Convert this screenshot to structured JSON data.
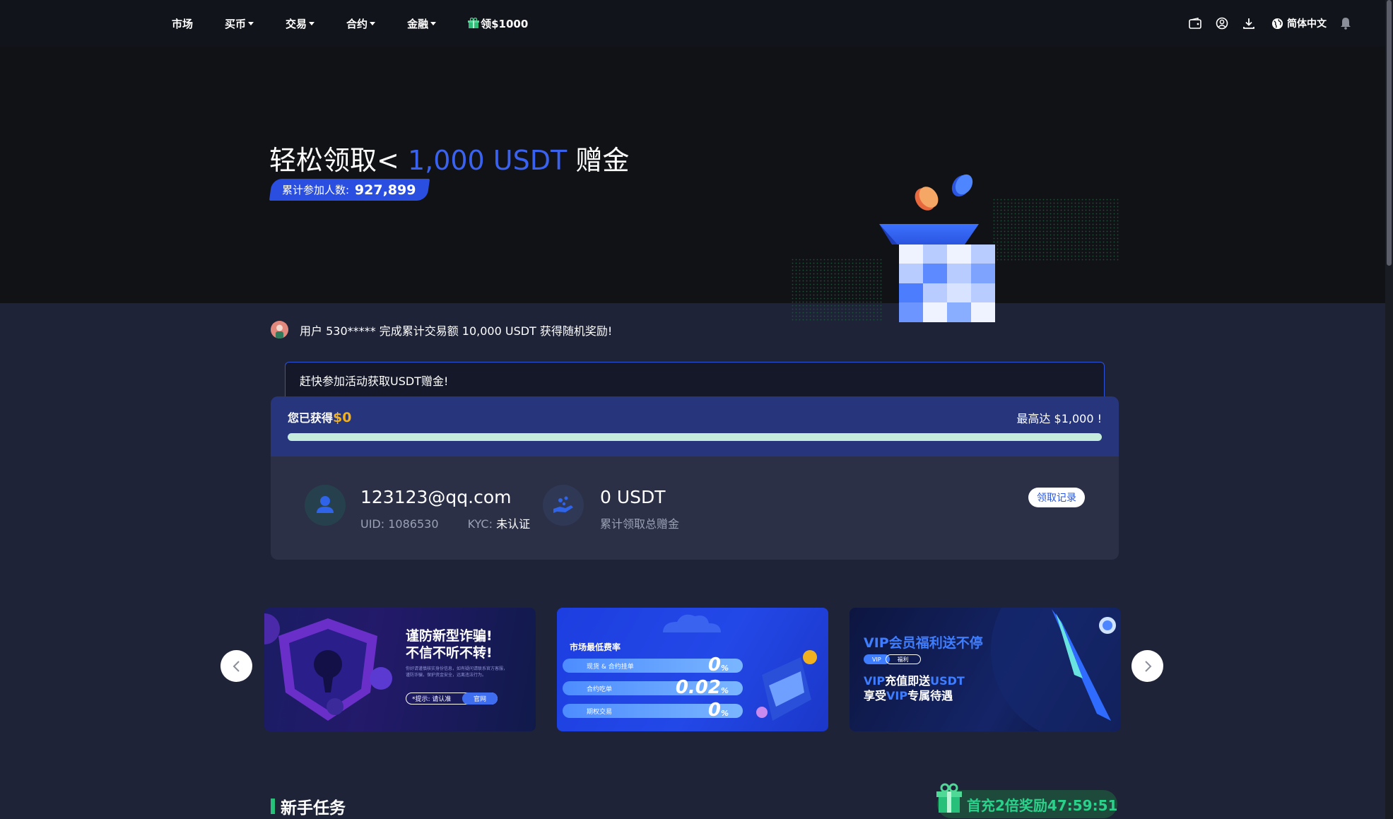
{
  "nav": {
    "items": [
      {
        "label": "市场",
        "dropdown": false
      },
      {
        "label": "买币",
        "dropdown": true
      },
      {
        "label": "交易",
        "dropdown": true
      },
      {
        "label": "合约",
        "dropdown": true
      },
      {
        "label": "金融",
        "dropdown": true
      },
      {
        "label": "领$1000",
        "dropdown": false
      }
    ],
    "language": "简体中文",
    "icons": [
      "wallet-icon",
      "user-icon",
      "download-icon",
      "globe-icon",
      "bell-icon"
    ]
  },
  "hero": {
    "title_prefix": "轻松领取<",
    "title_amount": "1,000 USDT",
    "title_suffix": "赠金",
    "participants_label": "累计参加人数:",
    "participants_value": "927,899"
  },
  "ticker": {
    "message": "用户 530***** 完成累计交易额 10,000 USDT 获得随机奖励!"
  },
  "notice": {
    "text": "赶快参加活动获取USDT赠金!"
  },
  "reward_card": {
    "earned_label": "您已获得",
    "earned_value": "$0",
    "max_label": "最高达 $1,000 !",
    "progress": 0,
    "email": "123123@qq.com",
    "uid_label": "UID:",
    "uid_value": "1086530",
    "kyc_label": "KYC:",
    "kyc_value": "未认证",
    "bonus_value": "0 USDT",
    "bonus_label": "累计领取总赠金",
    "record_button": "领取记录"
  },
  "banners": {
    "b1": {
      "title_line1": "谨防新型诈骗!",
      "title_line2": "不信不听不转!",
      "small_text": "你好请谨慎核实身份信息，如有疑问请联系官方客服，谨防诈骗，保护资金安全，远离违法行为。",
      "tip": "*提示: 请认准",
      "tip_button": "官网"
    },
    "b2": {
      "title": "市场最低费率",
      "rows": [
        {
          "label": "现货 & 合约挂单",
          "value": "0",
          "unit": "%"
        },
        {
          "label": "合约吃单",
          "value": "0.02",
          "unit": "%"
        },
        {
          "label": "期权交易",
          "value": "0",
          "unit": "%"
        }
      ]
    },
    "b3": {
      "title": "VIP会员福利送不停",
      "tag1": "VIP",
      "tag2": "福利",
      "line1_a": "VIP",
      "line1_b": "充值即送",
      "line1_c": "USDT",
      "line2_a": "享受",
      "line2_b": "VIP",
      "line2_c": "专属待遇"
    }
  },
  "section": {
    "title": "新手任务",
    "promo": "首充2倍奖励47:59:51"
  },
  "colors": {
    "accent_blue": "#3a62f0",
    "gold": "#f0b020",
    "green": "#27c07a",
    "bg": "#1e2338",
    "hero_bg": "#111216"
  }
}
